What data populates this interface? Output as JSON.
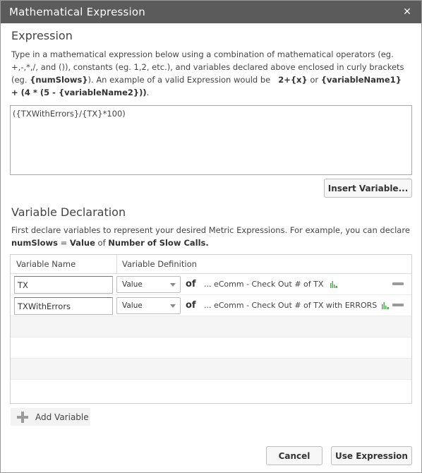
{
  "dialog": {
    "title": "Mathematical Expression",
    "close_glyph": "✕"
  },
  "expression": {
    "heading": "Expression",
    "desc_part1": "Type in a mathematical expression below using a combination of mathematical operators (eg. +,-,*,/, and ()), constants (eg. 1,2, etc.), and variables declared above enclosed in curly brackets (eg. ",
    "desc_var": "{numSlows}",
    "desc_part2": "). An example of a valid Expression would be ",
    "desc_example1": "2+{x}",
    "desc_or": " or ",
    "desc_example2": "{variableName1} + (4 * (5 - {variableName2}))",
    "desc_end": ".",
    "value": "({TXWithErrors}/{TX}*100)",
    "insert_button": "Insert Variable..."
  },
  "variable_declaration": {
    "heading": "Variable Declaration",
    "desc_part1": "First declare variables to represent your desired Metric Expressions. For example, you can declare ",
    "desc_name": "numSlows",
    "desc_eq": " = ",
    "desc_value": "Value",
    "desc_of": " of ",
    "desc_metric": "Number of Slow Calls",
    "desc_end": ".",
    "col_name": "Variable Name",
    "col_definition": "Variable Definition",
    "rows": [
      {
        "name": "TX",
        "type": "Value",
        "of": "of",
        "metric": "... eComm - Check Out # of TX",
        "chart_icon": "bar-chart-icon",
        "remove_icon": "minus-icon"
      },
      {
        "name": "TXWithErrors",
        "type": "Value",
        "of": "of",
        "metric": "... eComm - Check Out # of TX with ERRORS",
        "chart_icon": "bar-chart-icon",
        "remove_icon": "minus-icon"
      }
    ],
    "add_button": "Add Variable",
    "add_icon": "plus-icon"
  },
  "footer": {
    "cancel": "Cancel",
    "use": "Use Expression"
  },
  "colors": {
    "titlebar": "#5b5b5b",
    "chart_icon": "#4caf50",
    "remove_icon": "#9a9a9a"
  }
}
